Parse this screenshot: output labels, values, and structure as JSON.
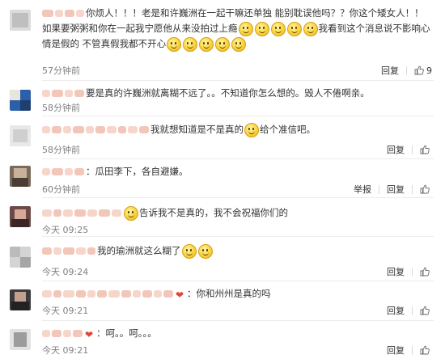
{
  "labels": {
    "reply": "回复",
    "report": "举报"
  },
  "colors": {
    "username": "#eb7350",
    "time": "#808080"
  },
  "comments": [
    {
      "text_a": "你烦人！！！老是和许巍洲在一起干嘛还单独 能别耽误他吗？？你这个矮女人！！如果要粥粥和你在一起我宁愿他从来没拍过上瘾",
      "text_b": "我看到这个消息说不影响心情是假的 不管真假我都不开心",
      "time": "57分钟前",
      "likes": "9"
    },
    {
      "text": "要是真的许巍洲就离糊不远了。。不知道你怎么想的。毁人不倦啊亲。",
      "time": "58分钟前",
      "likes": ""
    },
    {
      "text_a": "我就想知道是不是真的",
      "text_b": "给个准信吧。",
      "time": "58分钟前",
      "likes": ""
    },
    {
      "text": "：瓜田李下，各自避嫌。",
      "time": "60分钟前",
      "likes": ""
    },
    {
      "text": "告诉我不是真的，我不会祝福你们的",
      "time": "今天 09:25",
      "likes": ""
    },
    {
      "text": "我的瑜洲就这么糊了",
      "time": "今天 09:24",
      "likes": ""
    },
    {
      "text": "：你和州州是真的吗",
      "time": "今天 09:21",
      "likes": ""
    },
    {
      "text": "：呵。。呵。。。",
      "time": "今天 09:21",
      "likes": ""
    }
  ]
}
